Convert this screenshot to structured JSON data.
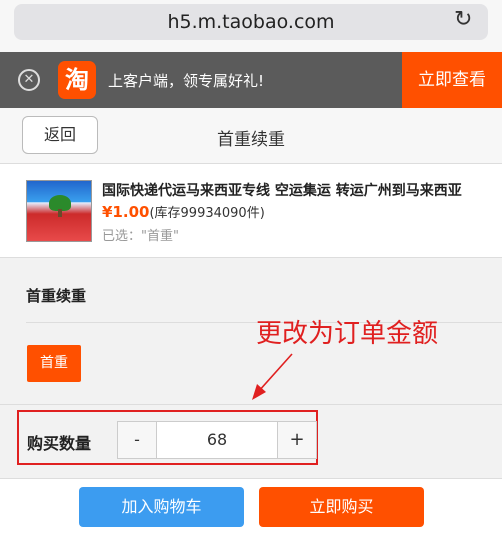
{
  "browser": {
    "url": "h5.m.taobao.com",
    "reload_icon": "reload-icon"
  },
  "promo": {
    "close_icon": "close-circle-icon",
    "logo_char": "淘",
    "text": "上客户端，领专属好礼!",
    "button": "立即查看"
  },
  "nav": {
    "back": "返回",
    "title": "首重续重"
  },
  "product": {
    "title": "国际快递代运马来西亚专线 空运集运 转运广州到马来西亚",
    "price": "¥1.00",
    "stock": "(库存99934090件)",
    "selected": "已选：\"首重\""
  },
  "sku": {
    "section_title": "首重续重",
    "option": "首重"
  },
  "annotation": {
    "text": "更改为订单金额",
    "color": "#e02020"
  },
  "quantity": {
    "label": "购买数量",
    "minus": "-",
    "value": "68",
    "plus": "+"
  },
  "actions": {
    "add_to_cart": "加入购物车",
    "buy_now": "立即购买"
  },
  "colors": {
    "accent": "#ff5000",
    "cart_blue": "#3c9cf0"
  }
}
